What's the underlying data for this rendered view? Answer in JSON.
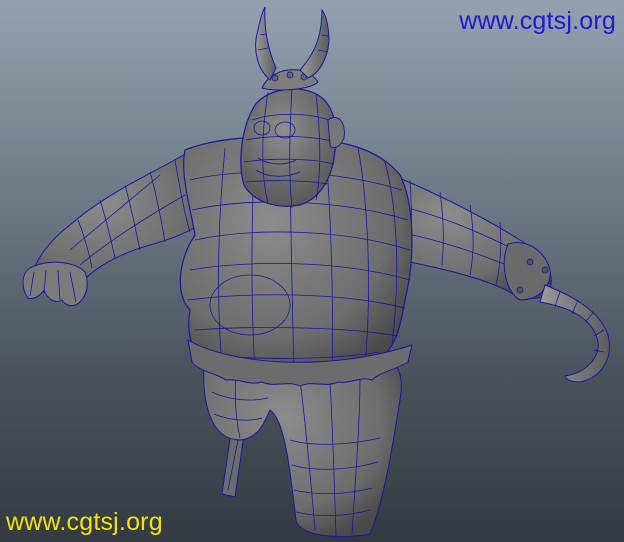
{
  "viewport": {
    "subject": "ogre-viking-wireframe-model",
    "background_top": "#95a1ae",
    "background_bottom": "#343a41",
    "mesh_fill": "#7a7a7a",
    "wire_color": "#1818a0"
  },
  "watermarks": {
    "top_right": "www.cgtsj.org",
    "top_right_color": "#1a1ad8",
    "bottom_left": "www.cgtsj.org",
    "bottom_left_color": "#f2e400"
  }
}
